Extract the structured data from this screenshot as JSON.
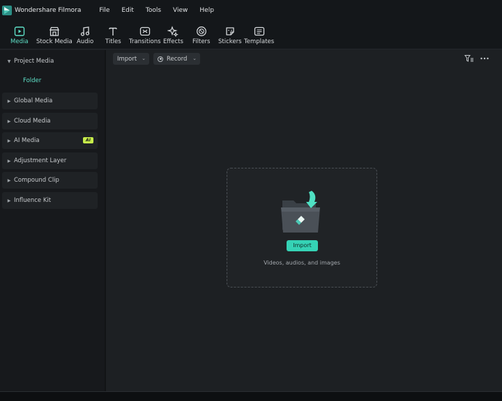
{
  "app": {
    "name": "Wondershare Filmora"
  },
  "menu": [
    "File",
    "Edit",
    "Tools",
    "View",
    "Help"
  ],
  "toolbar": {
    "tools": [
      {
        "label": "Media",
        "icon": "media-icon",
        "active": true
      },
      {
        "label": "Stock Media",
        "icon": "stock-media-icon",
        "active": false
      },
      {
        "label": "Audio",
        "icon": "audio-icon",
        "active": false
      },
      {
        "label": "Titles",
        "icon": "titles-icon",
        "active": false
      },
      {
        "label": "Transitions",
        "icon": "transitions-icon",
        "active": false
      },
      {
        "label": "Effects",
        "icon": "effects-icon",
        "active": false
      },
      {
        "label": "Filters",
        "icon": "filters-icon",
        "active": false
      },
      {
        "label": "Stickers",
        "icon": "stickers-icon",
        "active": false
      },
      {
        "label": "Templates",
        "icon": "templates-icon",
        "active": false
      }
    ]
  },
  "sidebar": {
    "project_media": "Project Media",
    "folder": "Folder",
    "items": [
      {
        "label": "Global Media"
      },
      {
        "label": "Cloud Media"
      },
      {
        "label": "AI Media",
        "badge": "AI"
      },
      {
        "label": "Adjustment Layer"
      },
      {
        "label": "Compound Clip"
      },
      {
        "label": "Influence Kit"
      }
    ]
  },
  "main": {
    "import_label": "Import",
    "record_label": "Record",
    "dropzone": {
      "button": "Import",
      "hint": "Videos, audios, and images"
    }
  },
  "colors": {
    "accent": "#5ee0c7",
    "import_button": "#35d2b5",
    "ai_badge": "#c6ec4a"
  }
}
